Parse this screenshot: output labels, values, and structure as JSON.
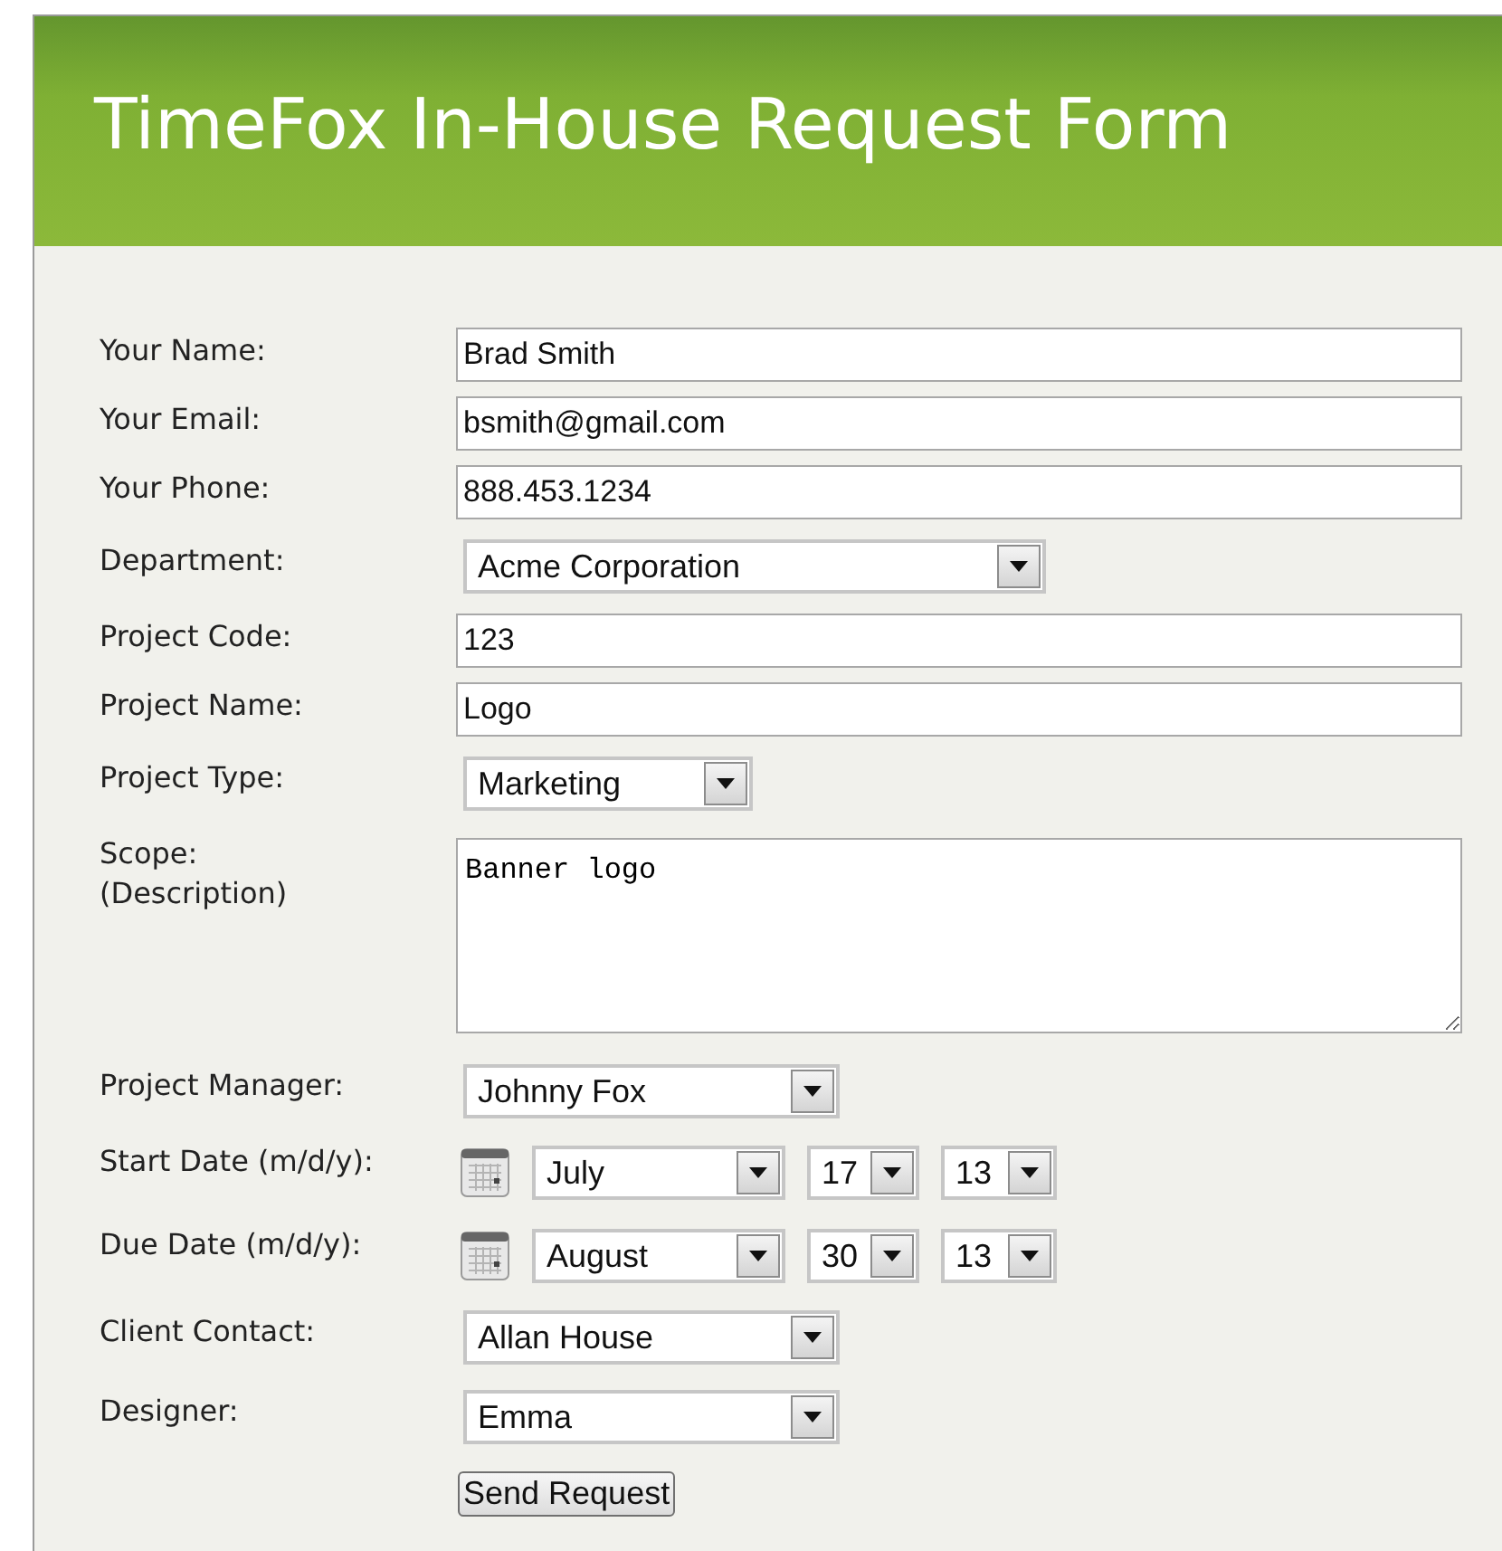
{
  "header": {
    "title": "TimeFox In-House Request Form"
  },
  "fields": [
    {
      "label": "Your Name:",
      "kind": "text",
      "value": "Brad Smith"
    },
    {
      "label": "Your Email:",
      "kind": "text",
      "value": "bsmith@gmail.com"
    },
    {
      "label": "Your Phone:",
      "kind": "text",
      "value": "888.453.1234"
    },
    {
      "label": "Department:",
      "kind": "select",
      "value": "Acme Corporation"
    },
    {
      "label": "Project Code:",
      "kind": "text",
      "value": "123"
    },
    {
      "label": "Project Name:",
      "kind": "text",
      "value": "Logo"
    },
    {
      "label": "Project Type:",
      "kind": "select",
      "value": "Marketing"
    },
    {
      "label": "Scope:",
      "sublabel": "(Description)",
      "kind": "textarea",
      "value": "Banner logo"
    },
    {
      "label": "Project Manager:",
      "kind": "select",
      "value": "Johnny Fox"
    },
    {
      "label": "Start Date (m/d/y):",
      "kind": "date",
      "month": "July",
      "day": "17",
      "year": "13"
    },
    {
      "label": "Due Date (m/d/y):",
      "kind": "date",
      "month": "August",
      "day": "30",
      "year": "13"
    },
    {
      "label": "Client Contact:",
      "kind": "select",
      "value": "Allan House"
    },
    {
      "label": "Designer:",
      "kind": "select",
      "value": "Emma"
    }
  ],
  "submit": {
    "label": "Send Request"
  }
}
